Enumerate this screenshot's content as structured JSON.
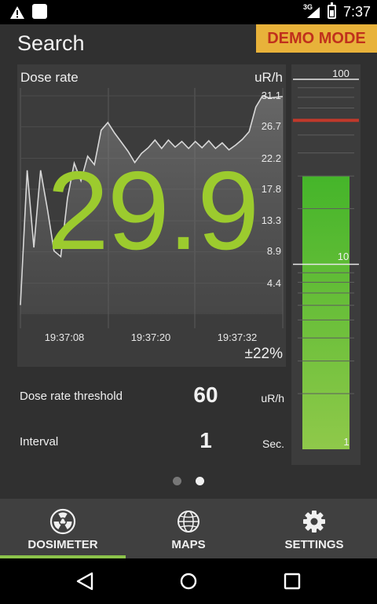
{
  "status_bar": {
    "network_type": "3G",
    "time": "7:37"
  },
  "header": {
    "title": "Search",
    "badge": "DEMO MODE"
  },
  "chart_data": {
    "type": "line",
    "title": "Dose rate",
    "unit": "uR/h",
    "ylim": [
      0,
      31.1
    ],
    "y_ticks": [
      "31.1",
      "26.7",
      "22.2",
      "17.8",
      "13.3",
      "8.9",
      "4.4"
    ],
    "x_ticks": [
      "19:37:08",
      "19:37:20",
      "19:37:32"
    ],
    "series": [
      {
        "color": "#d8d8d8",
        "x": [
          0,
          1,
          2,
          3,
          4,
          5,
          6,
          7,
          8,
          9,
          10,
          11,
          12,
          13,
          14,
          15,
          16,
          17,
          18,
          19,
          20,
          21,
          22,
          23,
          24,
          25,
          26,
          27,
          28,
          29,
          30,
          31,
          32,
          33,
          34,
          35,
          36,
          37,
          38,
          39
        ],
        "values": [
          1.3,
          20.5,
          9.5,
          20.5,
          15.0,
          9.0,
          8.2,
          16.5,
          21.5,
          19.0,
          22.5,
          21.3,
          26.2,
          27.3,
          25.8,
          24.5,
          23.2,
          21.6,
          22.9,
          23.7,
          24.8,
          23.6,
          24.8,
          23.8,
          24.6,
          23.6,
          24.6,
          23.7,
          24.7,
          23.6,
          24.4,
          23.4,
          24.1,
          24.9,
          26.0,
          29.5,
          31.1,
          30.8,
          30.9,
          31.0
        ]
      }
    ]
  },
  "dose_rate": {
    "value": "29.9",
    "accuracy": "±22%"
  },
  "bar_gauge": {
    "scale_labels": [
      "100",
      "10",
      "1"
    ],
    "threshold_color": "#c0392b",
    "fill_color": "#52b32a",
    "current_value": 29.9,
    "threshold_value": 60
  },
  "settings": {
    "threshold_label": "Dose rate threshold",
    "threshold_value": "60",
    "threshold_unit": "uR/h",
    "interval_label": "Interval",
    "interval_value": "1",
    "interval_unit": "Sec."
  },
  "tabs": [
    {
      "label": "DOSIMETER",
      "icon": "radiation-icon",
      "active": true
    },
    {
      "label": "MAPS",
      "icon": "globe-icon",
      "active": false
    },
    {
      "label": "SETTINGS",
      "icon": "gear-icon",
      "active": false
    }
  ],
  "colors": {
    "accent": "#8bc34a",
    "value_green": "#9ccb2e",
    "demo_badge_bg": "#e8b23a",
    "demo_badge_text": "#c0301c"
  }
}
